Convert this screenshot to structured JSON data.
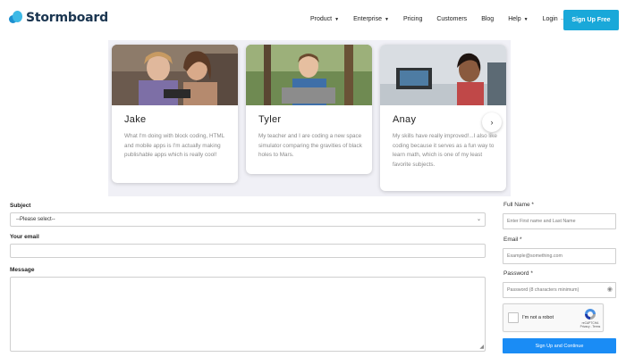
{
  "brand": {
    "name": "Stormboard"
  },
  "nav": [
    {
      "label": "Product",
      "dropdown": true
    },
    {
      "label": "Enterprise",
      "dropdown": true
    },
    {
      "label": "Pricing",
      "dropdown": false
    },
    {
      "label": "Customers",
      "dropdown": false
    },
    {
      "label": "Blog",
      "dropdown": false
    },
    {
      "label": "Help",
      "dropdown": true
    },
    {
      "label": "Login →",
      "dropdown": false
    }
  ],
  "header": {
    "signup_label": "Sign Up Free"
  },
  "testimonials": [
    {
      "name": "Jake",
      "quote": "What I'm doing with block coding, HTML and mobile apps is I'm actually making publishable apps which is really cool!"
    },
    {
      "name": "Tyler",
      "quote": "My teacher and I are coding a new space simulator comparing the gravities of black holes to Mars."
    },
    {
      "name": "Anay",
      "quote": "My skills have really improved!...I also like coding because it serves as a fun way to learn math, which is one of my least favorite subjects."
    }
  ],
  "carousel": {
    "next_icon": "chevron-right-icon",
    "next_glyph": "›"
  },
  "contact_form": {
    "subject_label": "Subject",
    "subject_value": "--Please select--",
    "email_label": "Your email",
    "email_value": "",
    "message_label": "Message",
    "message_value": ""
  },
  "signup_form": {
    "full_name_label": "Full Name *",
    "full_name_placeholder": "Enter First name and Last Name",
    "email_label": "Email *",
    "email_placeholder": "Example@something.com",
    "password_label": "Password *",
    "password_placeholder": "Password (8 characters minimum)",
    "captcha_label": "I'm not a robot",
    "captcha_brand": "reCAPTCHA",
    "captcha_links": "Privacy - Terms",
    "submit_label": "Sign Up and Continue"
  },
  "colors": {
    "accent": "#19a8d9",
    "submit": "#1a8cf5",
    "panel_bg": "#f0f0f6"
  }
}
